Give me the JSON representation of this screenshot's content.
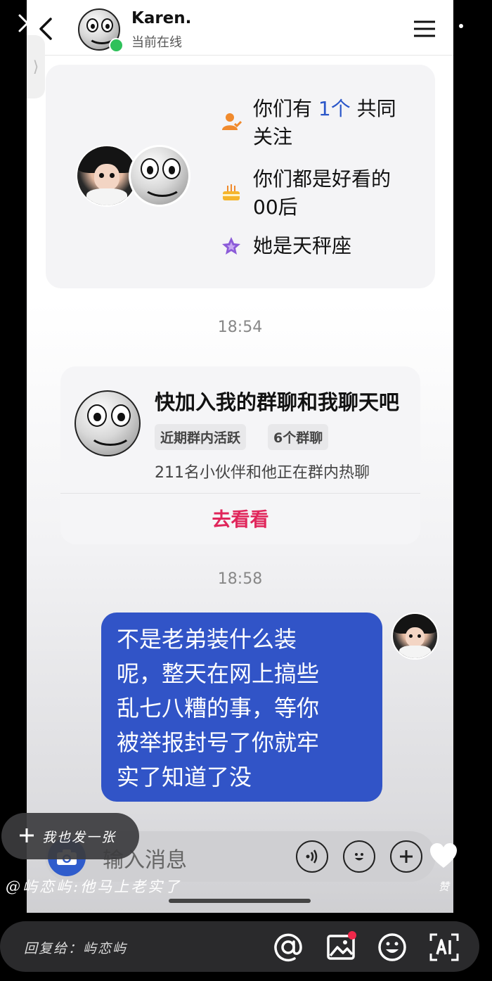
{
  "header": {
    "name": "Karen.",
    "status": "当前在线"
  },
  "info_card": {
    "line1_prefix": "你们有",
    "line1_count": "1个",
    "line1_suffix": "共同",
    "line1_cont": "关注",
    "line2": "你们都是好看的",
    "line2_cont": "00后",
    "line3": "她是天秤座"
  },
  "time1": "18:54",
  "group_card": {
    "title": "快加入我的群聊和我聊天吧",
    "tag1": "近期群内活跃",
    "tag2": "6个群聊",
    "desc": "211名小伙伴和他正在群内热聊",
    "action": "去看看"
  },
  "time2": "18:58",
  "message": {
    "lines": [
      "不是老弟装什么装",
      "呢，整天在网上搞些",
      "乱七八糟的事，等你",
      "被举报封号了你就牢",
      "实了知道了没"
    ]
  },
  "input": {
    "placeholder": "输入消息"
  },
  "overlay": {
    "post_label": "我也发一张",
    "comment": "@屿恋屿:他马上老实了",
    "like_label": "赞",
    "reply_label": "回复给：屿恋屿"
  },
  "colors": {
    "accent": "#2b57c9",
    "bubble": "#3154c7",
    "action": "#e0265b",
    "online": "#2ec15a"
  }
}
